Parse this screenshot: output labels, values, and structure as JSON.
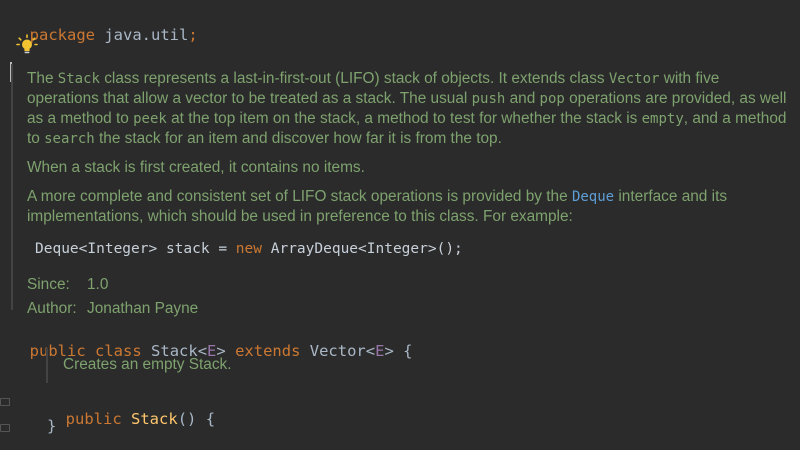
{
  "code": {
    "package_kw": "package",
    "package_name": "java.util",
    "semicolon": ";",
    "class_line": {
      "public": "public",
      "class": "class",
      "name": "Stack",
      "lt": "<",
      "type_param": "E",
      "gt": ">",
      "extends": "extends",
      "super": "Vector",
      "super_lt": "<",
      "super_param": "E",
      "super_gt": ">",
      "brace": "{"
    },
    "ctor_line": {
      "public": "public",
      "name": "Stack",
      "parens": "()",
      "brace": "{"
    },
    "close_brace": "}"
  },
  "javadoc": {
    "p1": {
      "t1": "The ",
      "c1": "Stack",
      "t2": " class represents a last-in-first-out (LIFO) stack of objects. It extends class ",
      "c2": "Vector",
      "t3": " with five operations that allow a vector to be treated as a stack. The usual ",
      "c3": "push",
      "t4": " and ",
      "c4": "pop",
      "t5": " operations are provided, as well as a method to ",
      "c5": "peek",
      "t6": " at the top item on the stack, a method to test for whether the stack is ",
      "c6": "empty",
      "t7": ", and a method to ",
      "c7": "search",
      "t8": " the stack for an item and discover how far it is from the top."
    },
    "p2": "When a stack is first created, it contains no items.",
    "p3": {
      "t1": "A more complete and consistent set of LIFO stack operations is provided by the ",
      "link": "Deque",
      "t2": " interface and its implementations, which should be used in preference to this class. For example:"
    },
    "example": {
      "p1": "Deque<Integer> stack = ",
      "kw": "new",
      "p2": " ArrayDeque<Integer>();"
    },
    "since_label": "Since:",
    "since_value": "1.0",
    "author_label": "Author:",
    "author_value": "Jonathan Payne",
    "ctor_doc": "Creates an empty Stack."
  },
  "colors": {
    "background": "#2b2b2b",
    "keyword": "#cc7832",
    "doc_text": "#7ea26e",
    "link": "#5e9ed6",
    "method": "#ffc66d",
    "type_param": "#9876aa"
  },
  "icons": {
    "bulb": "lightbulb-icon"
  }
}
